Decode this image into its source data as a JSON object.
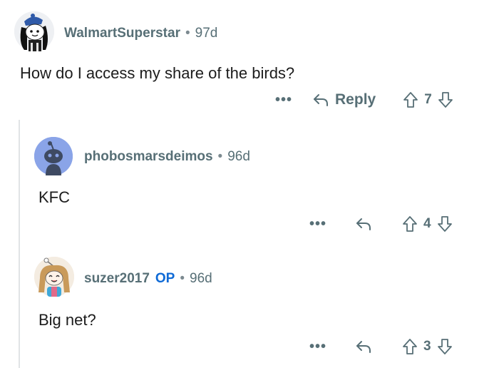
{
  "comments": [
    {
      "username": "WalmartSuperstar",
      "separator": "•",
      "age": "97d",
      "body": "How do I access my share of the birds?",
      "more_label": "•••",
      "reply_label": "Reply",
      "score": "7"
    },
    {
      "username": "phobosmarsdeimos",
      "separator": "•",
      "age": "96d",
      "body": "KFC",
      "more_label": "•••",
      "score": "4"
    },
    {
      "username": "suzer2017",
      "op_badge": "OP",
      "separator": "•",
      "age": "96d",
      "body": "Big net?",
      "more_label": "•••",
      "score": "3"
    }
  ],
  "icons": {
    "reply": "reply-arrow-icon",
    "upvote": "upvote-arrow-icon",
    "downvote": "downvote-arrow-icon",
    "more": "more-options-icon"
  },
  "colors": {
    "meta_gray": "#576f76",
    "op_blue": "#0f6ad6",
    "thread_line": "#e1e4e6",
    "avatar2_bg": "#8aa4e8"
  }
}
